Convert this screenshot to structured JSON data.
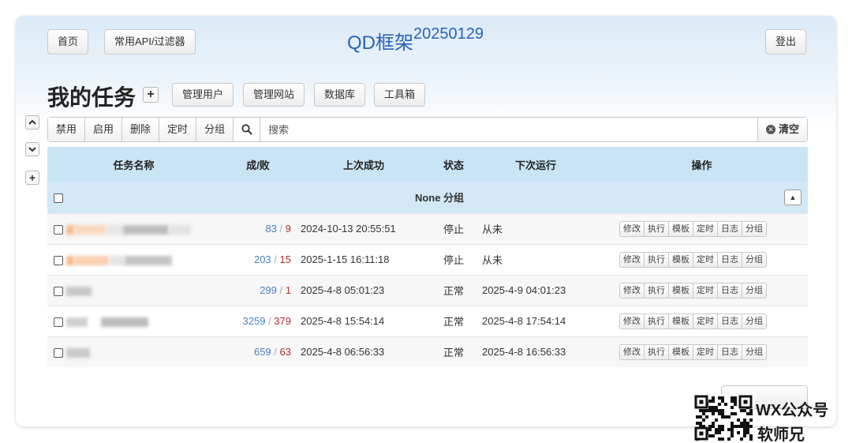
{
  "header": {
    "home_label": "首页",
    "api_label": "常用API/过滤器",
    "title": "QD框架",
    "version": "20250129",
    "logout_label": "登出"
  },
  "tasks_header": {
    "heading": "我的任务",
    "add_symbol": "+",
    "buttons": [
      "管理用户",
      "管理网站",
      "数据库",
      "工具箱"
    ]
  },
  "side": {
    "up_icon": "chevron-up-icon",
    "down_icon": "chevron-down-icon",
    "add_symbol": "+"
  },
  "toolbar": {
    "disable_label": "禁用",
    "enable_label": "启用",
    "delete_label": "删除",
    "schedule_label": "定时",
    "group_label": "分组",
    "search_placeholder": "搜索",
    "clear_label": "清空"
  },
  "table": {
    "columns": [
      "任务名称",
      "成/败",
      "上次成功",
      "状态",
      "下次运行",
      "操作"
    ],
    "group_label": "None 分组",
    "rows": [
      {
        "success": "83",
        "fail": "9",
        "last_success": "2024-10-13 20:55:51",
        "status": "停止",
        "next_run": "从未"
      },
      {
        "success": "203",
        "fail": "15",
        "last_success": "2025-1-15 16:11:18",
        "status": "停止",
        "next_run": "从未"
      },
      {
        "success": "299",
        "fail": "1",
        "last_success": "2025-4-8 05:01:23",
        "status": "正常",
        "next_run": "2025-4-9 04:01:23"
      },
      {
        "success": "3259",
        "fail": "379",
        "last_success": "2025-4-8 15:54:14",
        "status": "正常",
        "next_run": "2025-4-8 17:54:14"
      },
      {
        "success": "659",
        "fail": "63",
        "last_success": "2025-4-8 06:56:33",
        "status": "正常",
        "next_run": "2025-4-8 16:56:33"
      }
    ],
    "ops": [
      "修改",
      "执行",
      "模板",
      "定时",
      "日志",
      "分组"
    ]
  },
  "watermark": {
    "line1": "WX公众号",
    "line2": "软师兄"
  },
  "colors": {
    "title_blue": "#2a63b8",
    "success_blue": "#4a7fc1",
    "fail_red": "#b03030",
    "header_bg": "#c9e5f5"
  }
}
